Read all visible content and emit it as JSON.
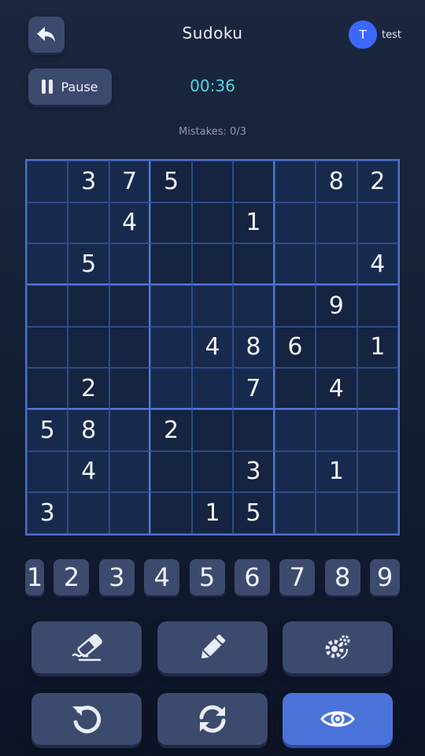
{
  "header": {
    "title": "Sudoku",
    "back_icon": "back-arrow-icon",
    "user": {
      "avatar_letter": "T",
      "name": "test",
      "avatar_color": "#3d68ff"
    }
  },
  "controls": {
    "pause_label": "Pause",
    "timer": "00:36",
    "mistakes": "Mistakes: 0/3"
  },
  "board": [
    [
      "",
      "3",
      "7",
      "5",
      "",
      "",
      "",
      "8",
      "2"
    ],
    [
      "",
      "",
      "4",
      "",
      "",
      "1",
      "",
      "",
      ""
    ],
    [
      "",
      "5",
      "",
      "",
      "",
      "",
      "",
      "",
      "4"
    ],
    [
      "",
      "",
      "",
      "",
      "",
      "",
      "",
      "9",
      ""
    ],
    [
      "",
      "",
      "",
      "",
      "4",
      "8",
      "6",
      "",
      "1"
    ],
    [
      "",
      "2",
      "",
      "",
      "",
      "7",
      "",
      "4",
      ""
    ],
    [
      "5",
      "8",
      "",
      "2",
      "",
      "",
      "",
      "",
      ""
    ],
    [
      "",
      "4",
      "",
      "",
      "",
      "3",
      "",
      "1",
      ""
    ],
    [
      "3",
      "",
      "",
      "",
      "1",
      "5",
      "",
      "",
      ""
    ]
  ],
  "numpad": [
    "1",
    "2",
    "3",
    "4",
    "5",
    "6",
    "7",
    "8",
    "9"
  ],
  "actions": [
    {
      "name": "erase-button",
      "icon": "eraser-icon"
    },
    {
      "name": "notes-button",
      "icon": "pencil-icon"
    },
    {
      "name": "settings-button",
      "icon": "gears-icon"
    },
    {
      "name": "undo-button",
      "icon": "undo-icon"
    },
    {
      "name": "restart-button",
      "icon": "refresh-icon"
    },
    {
      "name": "reveal-button",
      "icon": "eye-icon"
    }
  ],
  "colors": {
    "accent": "#4a73d9",
    "timer": "#4fd6e3",
    "button": "#3c4a6e",
    "grid_line": "#4f6fd0"
  }
}
